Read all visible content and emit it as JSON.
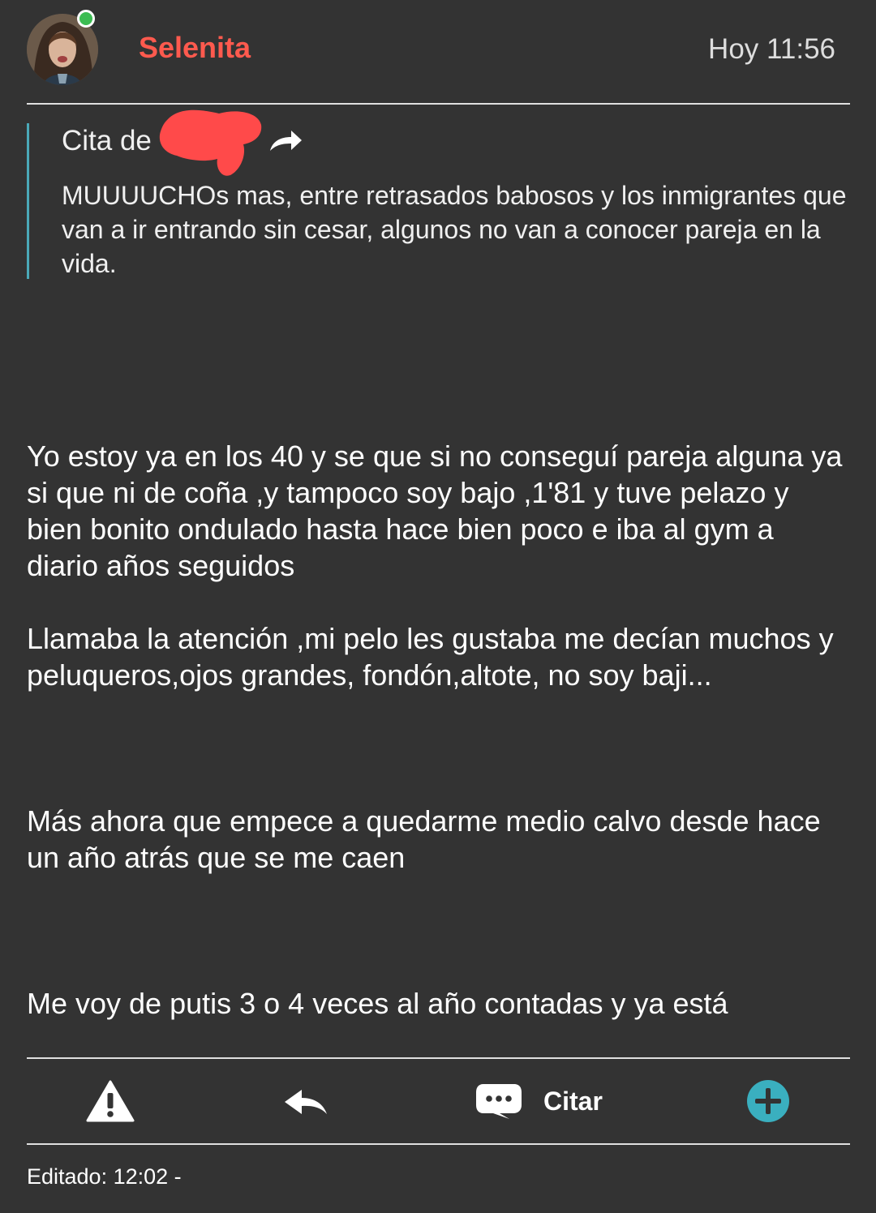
{
  "post": {
    "username": "Selenita",
    "time": "Hoy 11:56",
    "online": true
  },
  "quote": {
    "prefix": "Cita de",
    "author_redacted": true,
    "text": "MUUUUCHOs mas, entre retrasados babosos y los inmigrantes que van a ir entrando sin cesar, algunos no van a conocer pareja en la vida."
  },
  "body": {
    "paragraphs": [
      "Yo estoy ya en los 40 y se que si no conseguí pareja alguna ya si que ni de coña ,y tampoco soy bajo ,1'81 y tuve pelazo y bien bonito ondulado hasta hace bien poco e iba al gym a diario años seguidos",
      "Llamaba la atención ,mi pelo les gustaba me decían muchos y peluqueros,ojos grandes, fondón,altote, no soy baji...",
      "Más ahora que empece a quedarme medio calvo desde hace un año atrás que se me caen",
      "Me voy de putis 3 o 4 veces al año contadas y ya está"
    ]
  },
  "actions": {
    "report_icon": "warning-icon",
    "reply_icon": "reply-icon",
    "quote_icon": "speech-bubble-icon",
    "quote_label": "Citar",
    "more_icon": "plus-circle-icon"
  },
  "footer": {
    "edited": "Editado: 12:02 -"
  },
  "colors": {
    "background": "#333333",
    "username": "#ff5a4e",
    "quote_border": "#4aa9b8",
    "plus_button": "#3aafbf",
    "online": "#3cbc52",
    "redaction": "#ff4a4a"
  }
}
